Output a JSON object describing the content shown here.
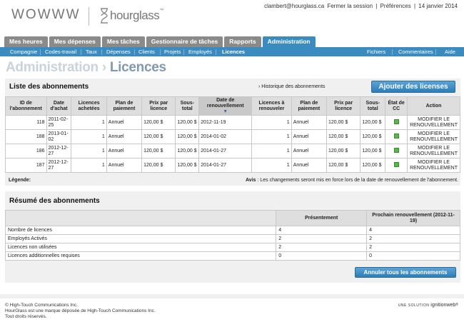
{
  "header": {
    "logo_left": "WOWWW",
    "logo_right": "hourglass",
    "logo_tm": "™",
    "user_email": "clambert@hourglass.ca",
    "logout_label": "Fermer la session",
    "prefs_label": "Préférences",
    "date": "14 janvier 2014",
    "sep": "|"
  },
  "tabs": [
    {
      "label": "Mes heures"
    },
    {
      "label": "Mes dépenses"
    },
    {
      "label": "Mes tâches"
    },
    {
      "label": "Gestionnaire de tâches"
    },
    {
      "label": "Rapports"
    },
    {
      "label": "Administration"
    }
  ],
  "subnav": {
    "left": [
      "Compagnie",
      "Codes-travail",
      "Taux",
      "Dépenses",
      "Clients",
      "Projets",
      "Employés",
      "Licences"
    ],
    "right": [
      "Fichiers",
      "Commentaires",
      "Aide"
    ]
  },
  "page_title": {
    "prefix": "Administration › ",
    "current": "Licences"
  },
  "subscriptions": {
    "title": "Liste des abonnements",
    "history_link": "› Historique des abonnements",
    "add_button": "Ajouter des licenses",
    "columns": [
      "ID de l'abonnement",
      "Date d'achat",
      "Licences achetées",
      "Plan de paiement",
      "Prix par licence",
      "Sous-total",
      "Date de renouvellement",
      "Licences à renouveler",
      "Plan de paiement",
      "Prix par licence",
      "Sous-total",
      "État de CC",
      "Action"
    ],
    "rows": [
      {
        "id": "118",
        "purchase_date": "2011-02-25",
        "bought": "1",
        "plan": "Annuel",
        "price": "120,00 $",
        "subtotal": "120,00 $",
        "renewal_date": "2012-11-19",
        "to_renew": "1",
        "renew_plan": "Annuel",
        "renew_price": "120,00 $",
        "renew_subtotal": "120,00 $",
        "action": "MODIFIER LE RENOUVELLEMENT"
      },
      {
        "id": "188",
        "purchase_date": "2013-01-02",
        "bought": "1",
        "plan": "Annuel",
        "price": "120,00 $",
        "subtotal": "120,00 $",
        "renewal_date": "2014-01-02",
        "to_renew": "1",
        "renew_plan": "Annuel",
        "renew_price": "120,00 $",
        "renew_subtotal": "120,00 $",
        "action": "MODIFIER LE RENOUVELLEMENT"
      },
      {
        "id": "186",
        "purchase_date": "2012-12-27",
        "bought": "1",
        "plan": "Annuel",
        "price": "120,00 $",
        "subtotal": "120,00 $",
        "renewal_date": "2014-01-27",
        "to_renew": "1",
        "renew_plan": "Annuel",
        "renew_price": "120,00 $",
        "renew_subtotal": "120,00 $",
        "action": "MODIFIER LE RENOUVELLEMENT"
      },
      {
        "id": "187",
        "purchase_date": "2012-12-27",
        "bought": "1",
        "plan": "Annuel",
        "price": "120,00 $",
        "subtotal": "120,00 $",
        "renewal_date": "2014-01-27",
        "to_renew": "1",
        "renew_plan": "Annuel",
        "renew_price": "120,00 $",
        "renew_subtotal": "120,00 $",
        "action": "MODIFIER LE RENOUVELLEMENT"
      }
    ],
    "legend_label": "Légende:",
    "notice_label": "Avis",
    "notice_text": " : Les changements seront mis en force lors de la date de renouvellement de l'abonnement."
  },
  "summary": {
    "title": "Résumé des abonnements",
    "col_current": "Présentement",
    "col_next": "Prochain renouvellement (2012-11-19)",
    "rows": [
      {
        "label": "Nombre de licences",
        "current": "4",
        "next": "4"
      },
      {
        "label": "Employés Activés",
        "current": "2",
        "next": "2"
      },
      {
        "label": "Licences non utilisées",
        "current": "2",
        "next": "2"
      },
      {
        "label": "Licences additionnelles requises",
        "current": "0",
        "next": "0"
      }
    ],
    "cancel_button": "Annuler tous les abonnements"
  },
  "footer": {
    "line1": "© High-Touch Communications Inc.",
    "line2": "HourGlass est une marque déposée de High-Touch Communications Inc.",
    "line3": "Tout droits réservés.",
    "brand_prefix": "UNE SOLUTION",
    "brand_name": "ignitionweb",
    "brand_tm": "®"
  },
  "colors": {
    "accent": "#3a8bc0",
    "tab_inactive": "#8a8a8a",
    "cc_ok": "#55b848"
  }
}
